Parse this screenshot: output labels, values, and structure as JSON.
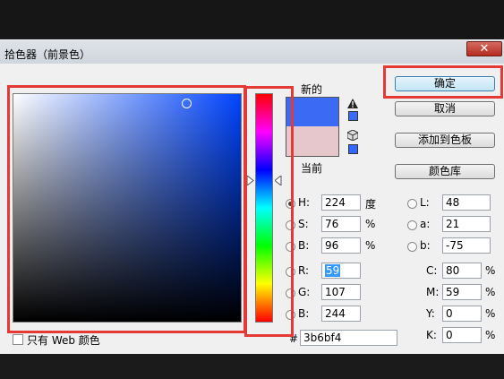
{
  "window": {
    "title": "拾色器（前景色）",
    "close_glyph": "✕"
  },
  "buttons": {
    "ok": "确定",
    "cancel": "取消",
    "add_to_swatches": "添加到色板",
    "color_libraries": "颜色库"
  },
  "preview": {
    "new_label": "新的",
    "current_label": "当前",
    "new_color": "#3b6bf4",
    "current_color": "#e5c7cc"
  },
  "hsb": {
    "h": {
      "label": "H:",
      "value": "224",
      "unit": "度",
      "selected": true
    },
    "s": {
      "label": "S:",
      "value": "76",
      "unit": "%"
    },
    "b": {
      "label": "B:",
      "value": "96",
      "unit": "%"
    }
  },
  "rgb": {
    "r": {
      "label": "R:",
      "value": "59"
    },
    "g": {
      "label": "G:",
      "value": "107"
    },
    "b": {
      "label": "B:",
      "value": "244"
    }
  },
  "lab": {
    "l": {
      "label": "L:",
      "value": "48"
    },
    "a": {
      "label": "a:",
      "value": "21"
    },
    "b": {
      "label": "b:",
      "value": "-75"
    }
  },
  "cmyk": {
    "c": {
      "label": "C:",
      "value": "80",
      "unit": "%"
    },
    "m": {
      "label": "M:",
      "value": "59",
      "unit": "%"
    },
    "y": {
      "label": "Y:",
      "value": "0",
      "unit": "%"
    },
    "k": {
      "label": "K:",
      "value": "0",
      "unit": "%"
    }
  },
  "hex": {
    "label": "#",
    "value": "3b6bf4"
  },
  "web_only": {
    "label": "只有 Web 颜色",
    "checked": false
  },
  "colors": {
    "hue_color": "#0044ff",
    "highlight_red": "#e53935"
  }
}
